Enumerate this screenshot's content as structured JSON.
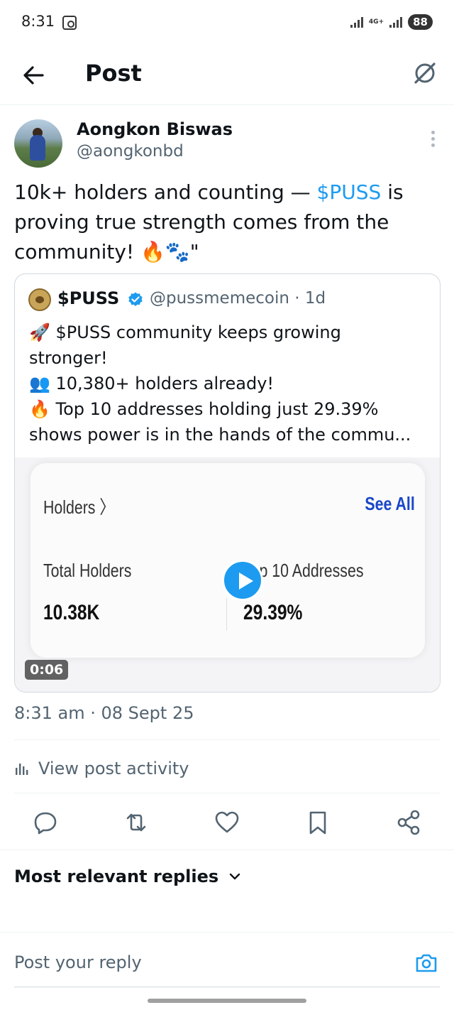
{
  "status_bar": {
    "time": "8:31",
    "network": "4G+",
    "battery": "88"
  },
  "header": {
    "title": "Post"
  },
  "tweet": {
    "author_name": "Aongkon Biswas",
    "author_handle": "@aongkonbd",
    "text_before": "10k+ holders and counting — ",
    "cashtag": "$PUSS",
    "text_after": " is proving true strength comes from the community! 🔥🐾\"",
    "timestamp": "8:31 am · 08 Sept 25"
  },
  "quote": {
    "name": "$PUSS",
    "handle_time": "@pussmemecoin · 1d",
    "lines": [
      "🚀 $PUSS community keeps growing",
      "stronger!",
      "👥 10,380+ holders already!",
      "🔥 Top 10 addresses holding just 29.39%",
      "shows power is in the hands of the commu..."
    ],
    "media": {
      "holders_label": "Holders 〉",
      "see_all": "See All",
      "total_holders_label": "Total Holders",
      "total_holders_value": "10.38K",
      "top10_label": "Top 10 Addresses",
      "top10_value": "29.39%",
      "duration": "0:06"
    }
  },
  "activity": {
    "label": "View post activity"
  },
  "actions": [
    "reply",
    "repost",
    "like",
    "bookmark",
    "share"
  ],
  "replies": {
    "sort_label": "Most relevant replies"
  },
  "composer": {
    "placeholder": "Post your reply"
  },
  "colors": {
    "accent": "#1d9bf0",
    "secondary_text": "#536471",
    "primary_text": "#0f1419"
  }
}
